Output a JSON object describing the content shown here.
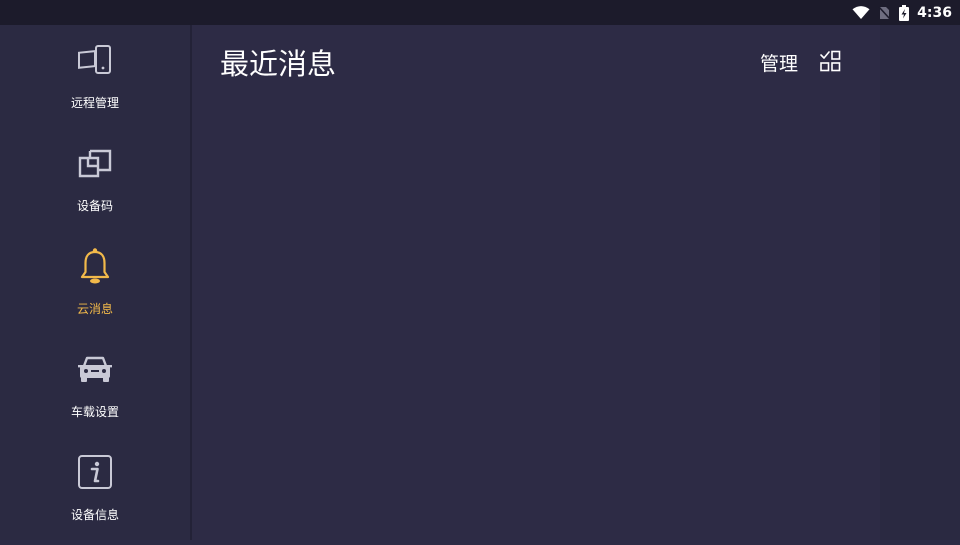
{
  "status_bar": {
    "time": "4:36",
    "icons": [
      "wifi-icon",
      "no-sim-icon",
      "battery-charging-icon"
    ]
  },
  "sidebar": {
    "items": [
      {
        "label": "远程管理",
        "icon": "remote-devices-icon",
        "active": false
      },
      {
        "label": "设备码",
        "icon": "device-code-icon",
        "active": false
      },
      {
        "label": "云消息",
        "icon": "bell-icon",
        "active": true
      },
      {
        "label": "车载设置",
        "icon": "car-icon",
        "active": false
      },
      {
        "label": "设备信息",
        "icon": "info-icon",
        "active": false
      }
    ]
  },
  "main": {
    "title": "最近消息",
    "manage_label": "管理",
    "manage_icon": "multi-select-icon"
  },
  "colors": {
    "background": "#2d2b45",
    "sidebar": "#2b2a42",
    "statusbar": "#1c1b2b",
    "accent": "#f2b94a",
    "icon": "#c9c9d6",
    "text": "#ffffff"
  }
}
